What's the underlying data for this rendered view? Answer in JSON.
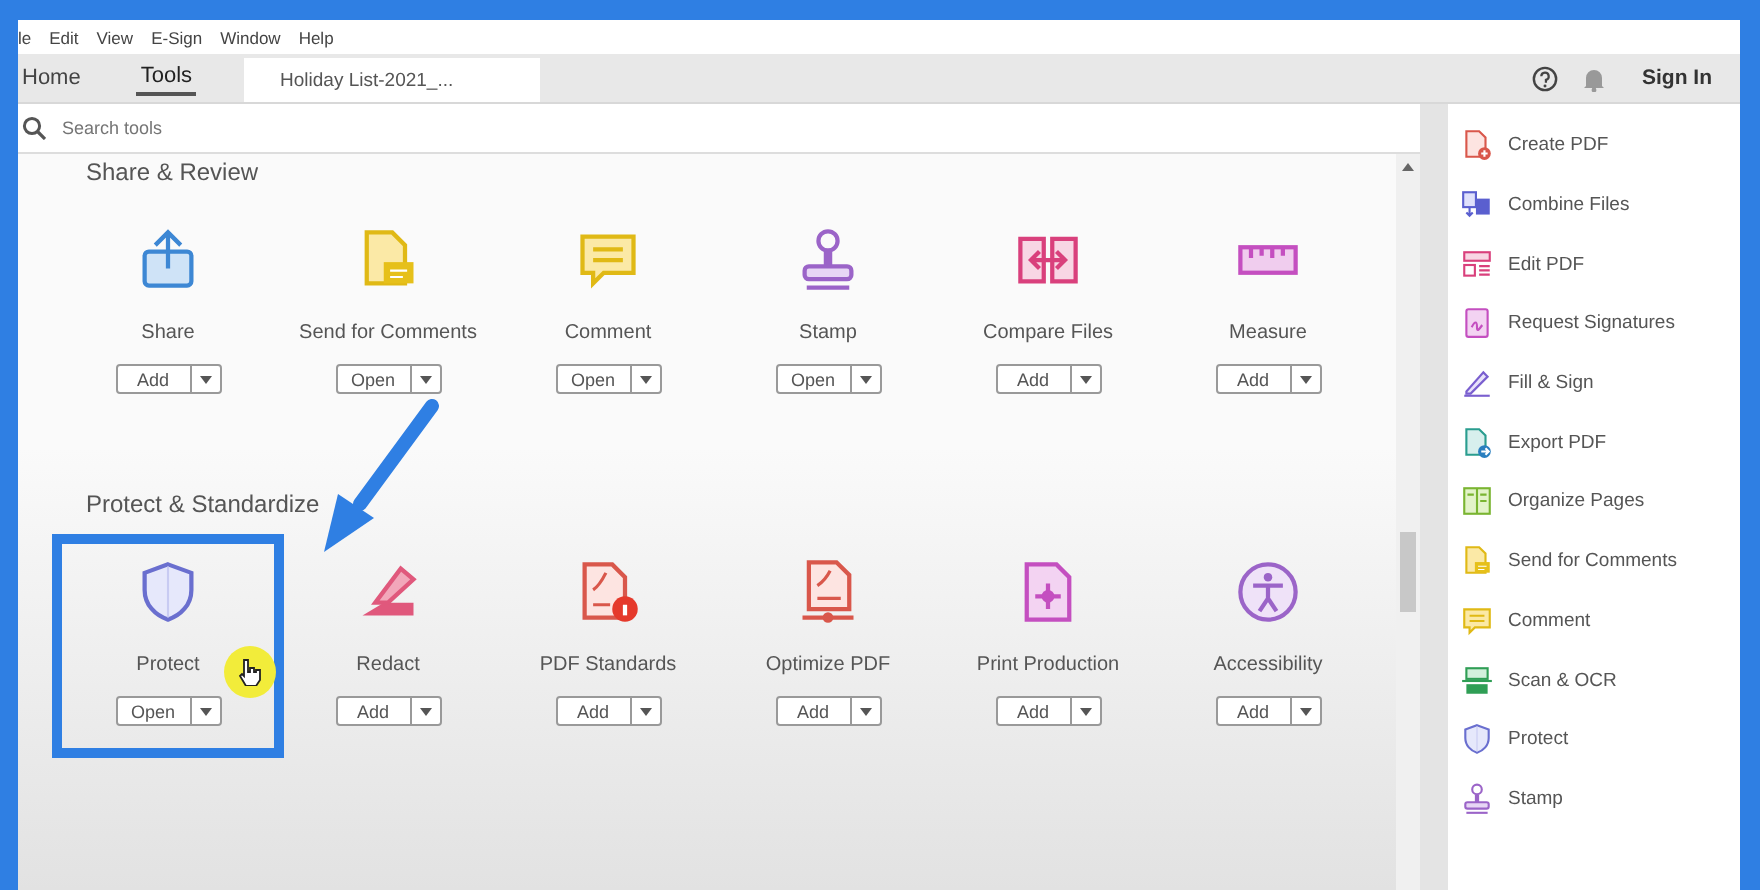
{
  "menu": [
    "le",
    "Edit",
    "View",
    "E-Sign",
    "Window",
    "Help"
  ],
  "tabs": [
    {
      "label": "Home",
      "selected": false
    },
    {
      "label": "Tools",
      "selected": true
    }
  ],
  "document_tab": "Holiday List-2021_...",
  "sign_in": "Sign In",
  "search": {
    "placeholder": "Search tools"
  },
  "sections": [
    {
      "title": "Share & Review",
      "tools": [
        {
          "name": "Share",
          "action": "Add",
          "kind": "share",
          "highlighted": false
        },
        {
          "name": "Send for Comments",
          "action": "Open",
          "kind": "send",
          "highlighted": false
        },
        {
          "name": "Comment",
          "action": "Open",
          "kind": "comment",
          "highlighted": false
        },
        {
          "name": "Stamp",
          "action": "Open",
          "kind": "stamp",
          "highlighted": false
        },
        {
          "name": "Compare Files",
          "action": "Add",
          "kind": "compare",
          "highlighted": false
        },
        {
          "name": "Measure",
          "action": "Add",
          "kind": "measure",
          "highlighted": false
        }
      ]
    },
    {
      "title": "Protect & Standardize",
      "tools": [
        {
          "name": "Protect",
          "action": "Open",
          "kind": "protect",
          "highlighted": true
        },
        {
          "name": "Redact",
          "action": "Add",
          "kind": "redact",
          "highlighted": false
        },
        {
          "name": "PDF Standards",
          "action": "Add",
          "kind": "standards",
          "highlighted": false
        },
        {
          "name": "Optimize PDF",
          "action": "Add",
          "kind": "optimize",
          "highlighted": false
        },
        {
          "name": "Print Production",
          "action": "Add",
          "kind": "print",
          "highlighted": false
        },
        {
          "name": "Accessibility",
          "action": "Add",
          "kind": "access",
          "highlighted": false
        }
      ]
    }
  ],
  "right_panel": [
    {
      "label": "Create PDF",
      "kind": "create"
    },
    {
      "label": "Combine Files",
      "kind": "combine"
    },
    {
      "label": "Edit PDF",
      "kind": "edit"
    },
    {
      "label": "Request Signatures",
      "kind": "request"
    },
    {
      "label": "Fill & Sign",
      "kind": "fill"
    },
    {
      "label": "Export PDF",
      "kind": "export"
    },
    {
      "label": "Organize Pages",
      "kind": "organize"
    },
    {
      "label": "Send for Comments",
      "kind": "send"
    },
    {
      "label": "Comment",
      "kind": "comment"
    },
    {
      "label": "Scan & OCR",
      "kind": "scan"
    },
    {
      "label": "Protect",
      "kind": "protect"
    },
    {
      "label": "Stamp",
      "kind": "stamp"
    }
  ]
}
